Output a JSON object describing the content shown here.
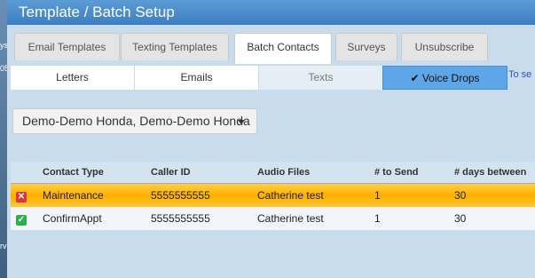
{
  "window": {
    "title": "Template / Batch Setup"
  },
  "background": {
    "fragments": [
      "ys",
      "05",
      "rv"
    ]
  },
  "tabs": [
    {
      "label": "Email Templates"
    },
    {
      "label": "Texting Templates"
    },
    {
      "label": "Batch Contacts",
      "active": true
    },
    {
      "label": "Surveys"
    },
    {
      "label": "Unsubscribe"
    }
  ],
  "subtabs": [
    {
      "label": "Letters"
    },
    {
      "label": "Emails"
    },
    {
      "label": "Texts"
    },
    {
      "label": "✔ Voice Drops",
      "selected": true
    }
  ],
  "to_send_text": "To se",
  "dealer_select": {
    "value": "Demo-Demo Honda, Demo-Demo Honda"
  },
  "table": {
    "columns": [
      "",
      "Contact Type",
      "Caller ID",
      "Audio Files",
      "# to Send",
      "# days between"
    ],
    "rows": [
      {
        "checked": false,
        "contact_type": "Maintenance",
        "caller_id": "5555555555",
        "audio_files": "Catherine test",
        "to_send": "1",
        "days_between": "30",
        "selected": true
      },
      {
        "checked": true,
        "contact_type": "ConfirmAppt",
        "caller_id": "5555555555",
        "audio_files": "Catherine test",
        "to_send": "1",
        "days_between": "30",
        "selected": false
      }
    ]
  },
  "colors": {
    "title_bar": "#3d7fc2",
    "selected_row": "#ffae00",
    "voice_tab": "#5fa6e8"
  }
}
